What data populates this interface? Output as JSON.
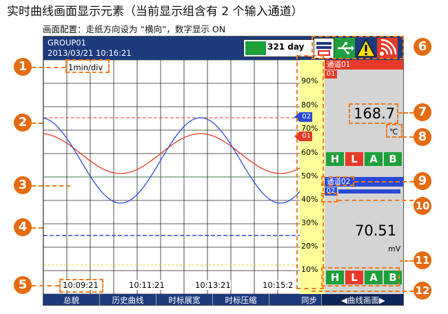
{
  "page_title": "实时曲线画面显示元素（当前显示组含有 2 个输入通道）",
  "subtitle": "画面配置：走纸方向设为 “横向”，数字显示 ON",
  "header": {
    "group": "GROUP01",
    "datetime": "2013/03/21  10:16:21",
    "days": "321 day"
  },
  "status_icons": {
    "icon1": "memory-card-icon",
    "icon2": "usb-icon",
    "icon3": "warning-icon",
    "icon4": "network-signal-icon"
  },
  "time_div": "1min/div",
  "scale_ticks": [
    "90%",
    "80%",
    "70%",
    "60%",
    "50%",
    "40%",
    "30%",
    "20%",
    "10%"
  ],
  "channels": [
    {
      "header": "通道01",
      "tag": "01",
      "value": "168.7",
      "unit": "℃",
      "color": "#e53a2a"
    },
    {
      "header": "通道02",
      "tag": "02",
      "value": "70.51",
      "unit": "mV",
      "color": "#2b4ad8"
    }
  ],
  "alarm_letters": [
    "H",
    "L",
    "A",
    "B"
  ],
  "time_labels": [
    "10:09:21",
    "10:11:21",
    "10:13:21",
    "10:15:2"
  ],
  "menu": [
    "总貌",
    "历史曲线",
    "时标展宽",
    "时标压缩",
    "同步",
    "◀曲线画面▶"
  ],
  "callouts": [
    "1",
    "2",
    "3",
    "4",
    "5",
    "6",
    "7",
    "8",
    "9",
    "10",
    "11",
    "12"
  ]
}
